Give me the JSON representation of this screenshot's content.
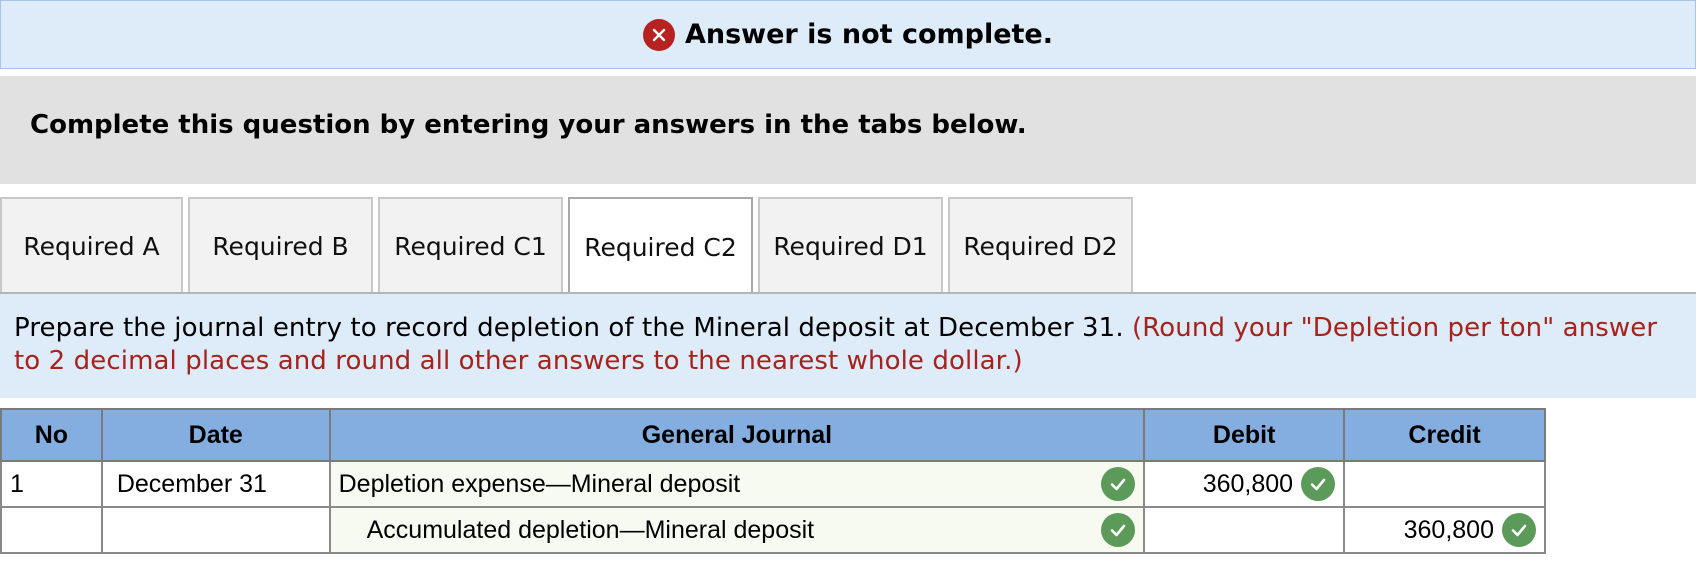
{
  "banner": {
    "message": "Answer is not complete.",
    "icon": "x-circle-icon",
    "icon_color": "#b5221f"
  },
  "instructions": "Complete this question by entering your answers in the tabs below.",
  "tabs": [
    {
      "label": "Required A",
      "active": false
    },
    {
      "label": "Required B",
      "active": false
    },
    {
      "label": "Required C1",
      "active": false
    },
    {
      "label": "Required C2",
      "active": true
    },
    {
      "label": "Required D1",
      "active": false
    },
    {
      "label": "Required D2",
      "active": false
    }
  ],
  "prompt": {
    "text": "Prepare the journal entry to record depletion of the Mineral deposit at December 31. ",
    "note": "(Round your \"Depletion per ton\" answer to 2 decimal places and round all other answers to the nearest whole dollar.)",
    "note_color": "#a6221d"
  },
  "journal": {
    "headers": {
      "no": "No",
      "date": "Date",
      "general_journal": "General Journal",
      "debit": "Debit",
      "credit": "Credit"
    },
    "rows": [
      {
        "no": "1",
        "date": "December 31",
        "account": "Depletion expense—Mineral deposit",
        "debit": "360,800",
        "credit": ""
      },
      {
        "no": "",
        "date": "",
        "account": "Accumulated depletion—Mineral deposit",
        "debit": "",
        "credit": "360,800"
      }
    ],
    "check_color": "#5c9a5a"
  }
}
